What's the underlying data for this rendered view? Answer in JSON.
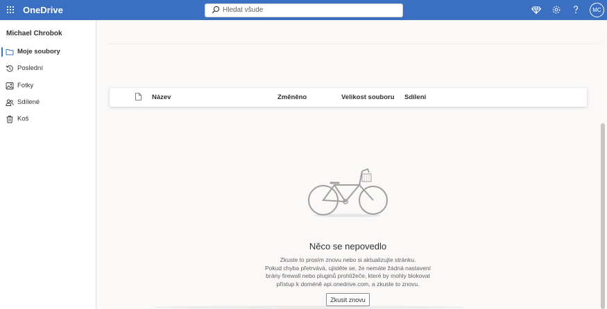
{
  "topbar": {
    "app_name": "OneDrive",
    "search_placeholder": "Hledat všude",
    "avatar_initials": "MC",
    "icons": [
      "app-launcher-icon",
      "premium-diamond-icon",
      "settings-gear-icon",
      "help-icon"
    ],
    "bar_color": "#3a6fc2"
  },
  "sidebar": {
    "user_name": "Michael Chrobok",
    "items": [
      {
        "label": "Moje soubory",
        "icon": "folder-icon",
        "active": true
      },
      {
        "label": "Poslední",
        "icon": "history-icon",
        "active": false
      },
      {
        "label": "Fotky",
        "icon": "photos-icon",
        "active": false
      },
      {
        "label": "Sdílené",
        "icon": "shared-people-icon",
        "active": false
      },
      {
        "label": "Koš",
        "icon": "trash-icon",
        "active": false
      }
    ]
  },
  "file_list": {
    "columns": [
      "Název",
      "Změněno",
      "Velikost souboru",
      "Sdílení"
    ]
  },
  "error": {
    "title": "Něco se nepovedlo",
    "lines": [
      "Zkuste to prosím znovu nebo si aktualizujte stránku.",
      "Pokud chyba přetrvává, ujistěte se, že nemáte žádná nastavení",
      "brány firewall nebo pluginů prohlížeče, které by mohly blokovat",
      "přístup k doméně api.onedrive.com, a zkuste to znovu."
    ],
    "retry_label": "Zkusit znovu",
    "illustration": "bicycle-illustration"
  }
}
